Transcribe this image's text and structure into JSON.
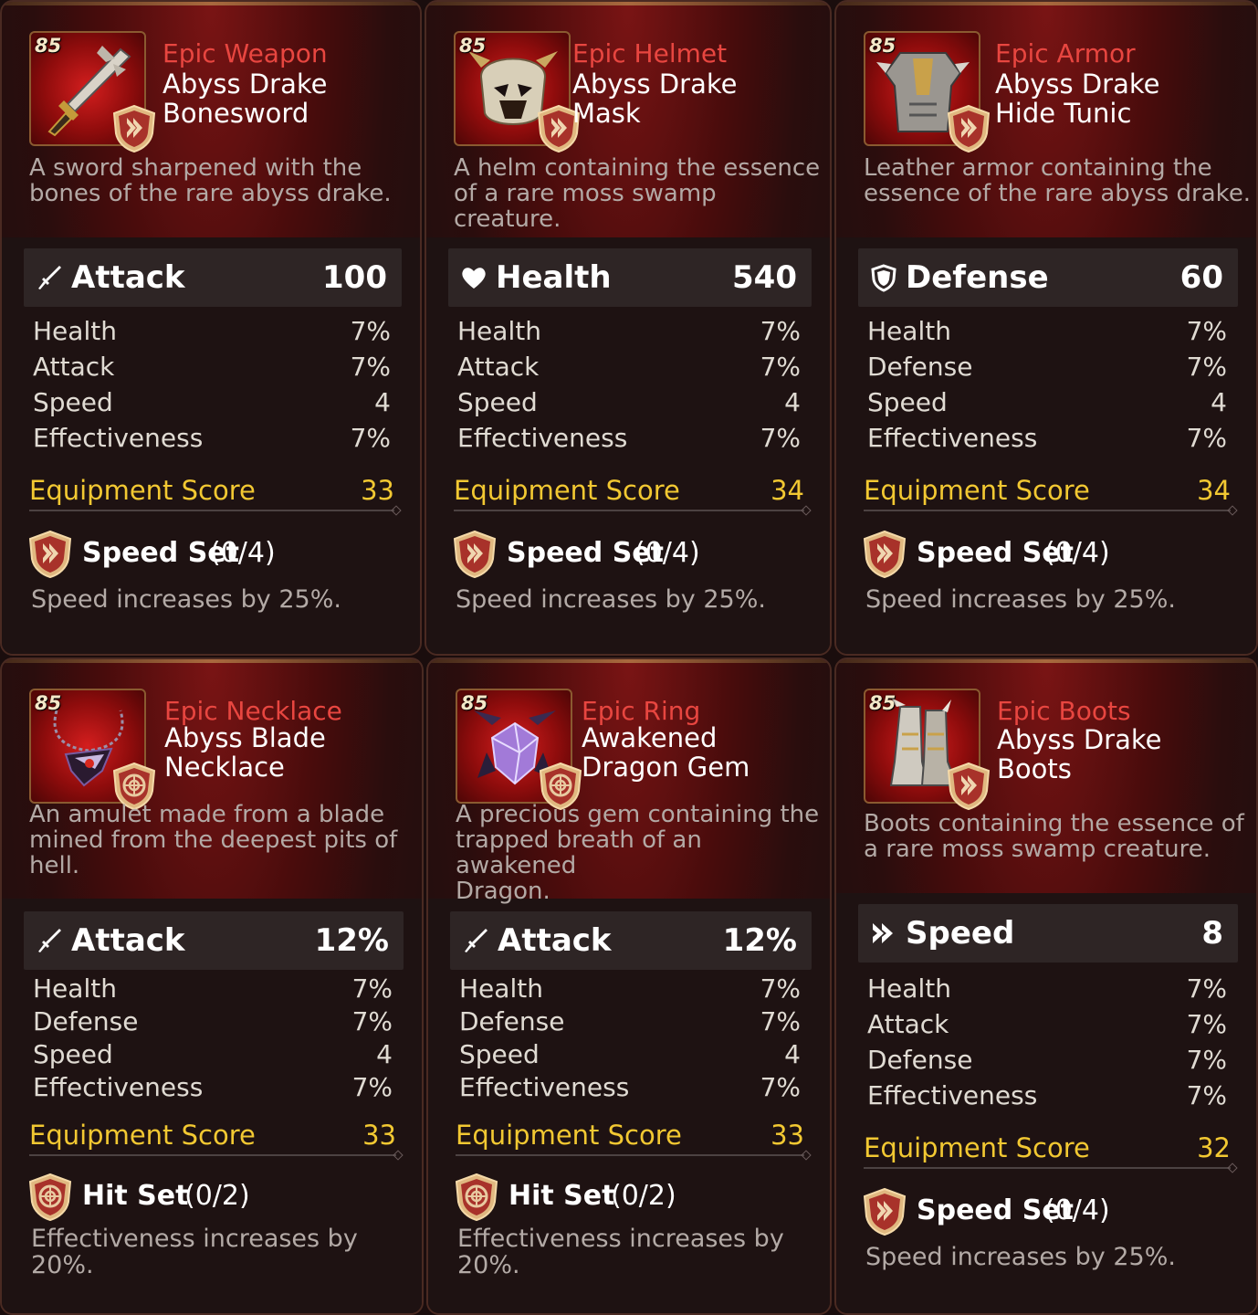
{
  "colors": {
    "rarity_epic": "#e84640",
    "score": "#f2c832",
    "text_white": "#ffffff",
    "text_muted": "#b3a9a5"
  },
  "cards": [
    {
      "level": "85",
      "rarity": "Epic Weapon",
      "name": "Abyss Drake\nBonesword",
      "flavor": "A sword sharpened with the\nbones of the rare abyss drake.",
      "main_stat": {
        "icon": "sword-icon",
        "name": "Attack",
        "value": "100"
      },
      "sub_stats": [
        {
          "name": "Health",
          "value": "7%"
        },
        {
          "name": "Attack",
          "value": "7%"
        },
        {
          "name": "Speed",
          "value": "4"
        },
        {
          "name": "Effectiveness",
          "value": "7%"
        }
      ],
      "score_label": "Equipment Score",
      "score": "33",
      "set": {
        "icon": "speed-set-icon",
        "name": "Speed Set",
        "count": "(0/4)",
        "desc": "Speed increases by 25%."
      }
    },
    {
      "level": "85",
      "rarity": "Epic Helmet",
      "name": "Abyss Drake\nMask",
      "flavor": "A helm containing the essence\nof a rare moss swamp creature.",
      "main_stat": {
        "icon": "heart-icon",
        "name": "Health",
        "value": "540"
      },
      "sub_stats": [
        {
          "name": "Health",
          "value": "7%"
        },
        {
          "name": "Attack",
          "value": "7%"
        },
        {
          "name": "Speed",
          "value": "4"
        },
        {
          "name": "Effectiveness",
          "value": "7%"
        }
      ],
      "score_label": "Equipment Score",
      "score": "34",
      "set": {
        "icon": "speed-set-icon",
        "name": "Speed Set",
        "count": "(0/4)",
        "desc": "Speed increases by 25%."
      }
    },
    {
      "level": "85",
      "rarity": "Epic Armor",
      "name": "Abyss Drake\nHide Tunic",
      "flavor": "Leather armor containing the\nessence of the rare abyss drake.",
      "main_stat": {
        "icon": "shield-icon",
        "name": "Defense",
        "value": "60"
      },
      "sub_stats": [
        {
          "name": "Health",
          "value": "7%"
        },
        {
          "name": "Defense",
          "value": "7%"
        },
        {
          "name": "Speed",
          "value": "4"
        },
        {
          "name": "Effectiveness",
          "value": "7%"
        }
      ],
      "score_label": "Equipment Score",
      "score": "34",
      "set": {
        "icon": "speed-set-icon",
        "name": "Speed Set",
        "count": "(0/4)",
        "desc": "Speed increases by 25%."
      }
    },
    {
      "level": "85",
      "rarity": "Epic Necklace",
      "name": "Abyss Blade\nNecklace",
      "flavor": "An amulet made from a blade\nmined from the deepest pits of\nhell.",
      "main_stat": {
        "icon": "sword-icon",
        "name": "Attack",
        "value": "12%"
      },
      "sub_stats": [
        {
          "name": "Health",
          "value": "7%"
        },
        {
          "name": "Defense",
          "value": "7%"
        },
        {
          "name": "Speed",
          "value": "4"
        },
        {
          "name": "Effectiveness",
          "value": "7%"
        }
      ],
      "score_label": "Equipment Score",
      "score": "33",
      "set": {
        "icon": "hit-set-icon",
        "name": "Hit Set",
        "count": "(0/2)",
        "desc": "Effectiveness increases by\n20%."
      }
    },
    {
      "level": "85",
      "rarity": "Epic Ring",
      "name": "Awakened\nDragon Gem",
      "flavor": "A precious gem containing the\ntrapped breath of an awakened\nDragon.",
      "main_stat": {
        "icon": "sword-icon",
        "name": "Attack",
        "value": "12%"
      },
      "sub_stats": [
        {
          "name": "Health",
          "value": "7%"
        },
        {
          "name": "Defense",
          "value": "7%"
        },
        {
          "name": "Speed",
          "value": "4"
        },
        {
          "name": "Effectiveness",
          "value": "7%"
        }
      ],
      "score_label": "Equipment Score",
      "score": "33",
      "set": {
        "icon": "hit-set-icon",
        "name": "Hit Set",
        "count": "(0/2)",
        "desc": "Effectiveness increases by\n20%."
      }
    },
    {
      "level": "85",
      "rarity": "Epic Boots",
      "name": "Abyss Drake\nBoots",
      "flavor": "Boots containing the essence of\na rare moss swamp creature.",
      "main_stat": {
        "icon": "speed-icon",
        "name": "Speed",
        "value": "8"
      },
      "sub_stats": [
        {
          "name": "Health",
          "value": "7%"
        },
        {
          "name": "Attack",
          "value": "7%"
        },
        {
          "name": "Defense",
          "value": "7%"
        },
        {
          "name": "Effectiveness",
          "value": "7%"
        }
      ],
      "score_label": "Equipment Score",
      "score": "32",
      "set": {
        "icon": "speed-set-icon",
        "name": "Speed Set",
        "count": "(0/4)",
        "desc": "Speed increases by 25%."
      }
    }
  ]
}
